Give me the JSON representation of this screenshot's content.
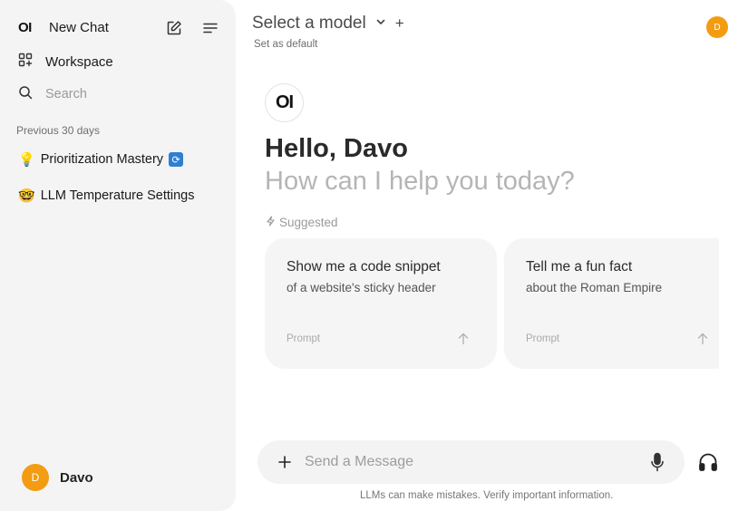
{
  "sidebar": {
    "logo": "OI",
    "new_chat_label": "New Chat",
    "workspace_label": "Workspace",
    "search_placeholder": "Search",
    "section_label": "Previous 30 days",
    "chats": [
      {
        "emoji": "💡",
        "title": "Prioritization Mastery",
        "badge": "🔄"
      },
      {
        "emoji": "🤓",
        "title": "LLM Temperature Settings"
      }
    ],
    "user": {
      "initial": "D",
      "name": "Davo"
    }
  },
  "header": {
    "model_select_label": "Select a model",
    "add_label": "+",
    "set_default_label": "Set as default",
    "avatar_initial": "D"
  },
  "main": {
    "logo": "OI",
    "greeting": "Hello, Davo",
    "subtitle": "How can I help you today?",
    "suggested_label": "Suggested",
    "suggestions": [
      {
        "title": "Show me a code snippet",
        "subtitle": "of a website's sticky header",
        "tag": "Prompt"
      },
      {
        "title": "Tell me a fun fact",
        "subtitle": "about the Roman Empire",
        "tag": "Prompt"
      }
    ]
  },
  "composer": {
    "placeholder": "Send a Message",
    "value": ""
  },
  "footer": {
    "disclaimer": "LLMs can make mistakes. Verify important information."
  },
  "colors": {
    "avatar": "#f39c12",
    "sidebar_bg": "#f4f4f4",
    "card_bg": "#f5f5f5"
  },
  "icons": [
    "compose-icon",
    "menu-icon",
    "workspace-icon",
    "search-icon",
    "chevron-down-icon",
    "bolt-icon",
    "arrow-up-icon",
    "plus-icon",
    "mic-icon",
    "headphones-icon"
  ]
}
